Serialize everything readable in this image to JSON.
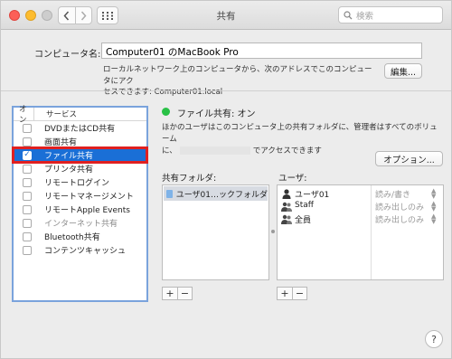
{
  "window": {
    "title": "共有",
    "search_placeholder": "検索"
  },
  "computer": {
    "label": "コンピュータ名:",
    "name": "Computer01 のMacBook Pro",
    "note_line1": "ローカルネットワーク上のコンピュータから、次のアドレスでこのコンピュータにアク",
    "note_line2": "セスできます: Computer01.local",
    "edit_label": "編集..."
  },
  "services": {
    "header_on": "オン",
    "header_service": "サービス",
    "items": [
      {
        "label": "DVDまたはCD共有",
        "checked": false,
        "selected": false
      },
      {
        "label": "画面共有",
        "checked": false,
        "selected": false
      },
      {
        "label": "ファイル共有",
        "checked": true,
        "selected": true
      },
      {
        "label": "プリンタ共有",
        "checked": false,
        "selected": false
      },
      {
        "label": "リモートログイン",
        "checked": false,
        "selected": false
      },
      {
        "label": "リモートマネージメント",
        "checked": false,
        "selected": false
      },
      {
        "label": "リモートApple Events",
        "checked": false,
        "selected": false
      },
      {
        "label": "インターネット共有",
        "checked": false,
        "selected": false,
        "dim": true
      },
      {
        "label": "Bluetooth共有",
        "checked": false,
        "selected": false
      },
      {
        "label": "コンテンツキャッシュ",
        "checked": false,
        "selected": false
      }
    ]
  },
  "detail": {
    "status": "ファイル共有: オン",
    "desc_line1": "ほかのユーザはこのコンピュータ上の共有フォルダに、管理者はすべてのボリューム",
    "desc_line2_pre": "に、",
    "desc_line2_post": "でアクセスできます",
    "options_label": "オプション...",
    "folders_label": "共有フォルダ:",
    "users_label": "ユーザ:",
    "folders": [
      "ユーザ01…ックフォルダ"
    ],
    "users": [
      {
        "name": "ユーザ01",
        "permission": "読み/書き",
        "icon": "single-user-icon"
      },
      {
        "name": "Staff",
        "permission": "読み出しのみ",
        "icon": "group-icon"
      },
      {
        "name": "全員",
        "permission": "読み出しのみ",
        "icon": "group-icon"
      }
    ],
    "add_symbol": "+",
    "remove_symbol": "−"
  },
  "help_symbol": "?"
}
